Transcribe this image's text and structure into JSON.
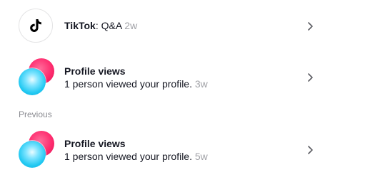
{
  "notifications": [
    {
      "type": "tiktok",
      "app_name": "TikTok",
      "message": ": Q&A",
      "time": "2w",
      "icon": "tiktok-logo-icon"
    },
    {
      "type": "profile_views",
      "title": "Profile views",
      "message": "1 person viewed your profile.",
      "time": "3w",
      "icon": "profile-views-icon"
    }
  ],
  "previous_section": {
    "label": "Previous",
    "items": [
      {
        "type": "profile_views",
        "title": "Profile views",
        "message": "1 person viewed your profile.",
        "time": "5w",
        "icon": "profile-views-icon"
      }
    ]
  },
  "colors": {
    "text_primary": "#161823",
    "text_secondary": "#a1a2a7",
    "accent_pink": "#fe2c6e",
    "accent_cyan": "#22c9f2"
  }
}
